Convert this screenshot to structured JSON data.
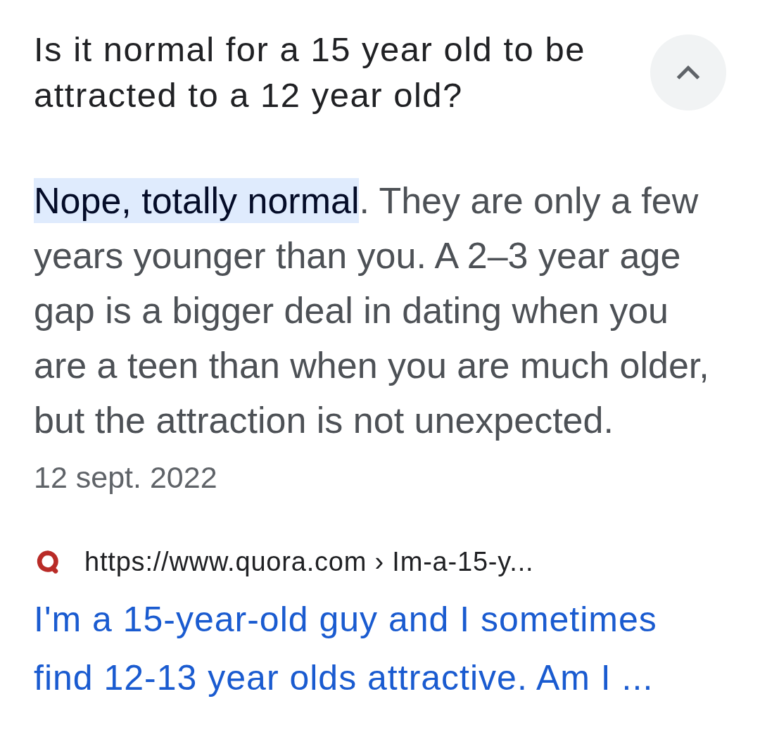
{
  "question": {
    "title": "Is it normal for a 15 year old to be attracted to a 12 year old?",
    "expanded": true
  },
  "answer": {
    "highlighted": "Nope, totally normal",
    "text": ". They are only a few years younger than you. A 2–3 year age gap is a bigger deal in dating when you are a teen than when you are much older, but the attraction is not unexpected.",
    "date": "12 sept. 2022"
  },
  "source": {
    "url": "https://www.quora.com › Im-a-15-y...",
    "title": "I'm a 15-year-old guy and I sometimes find 12-13 year olds attractive. Am I ..."
  }
}
